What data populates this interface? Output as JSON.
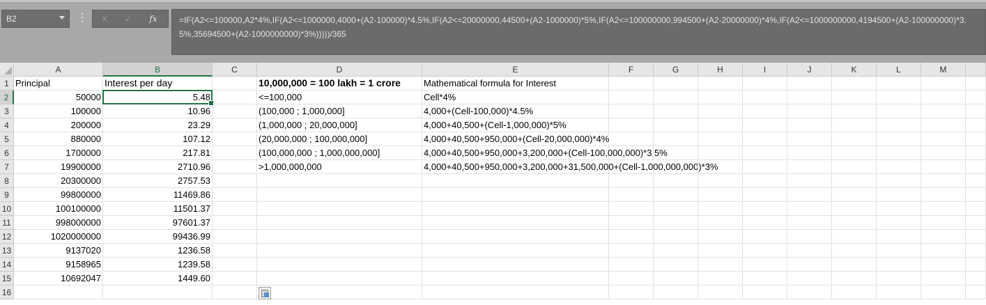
{
  "name_box": {
    "value": "B2"
  },
  "formula_bar": {
    "dots": "⋮",
    "cancel_icon": "✕",
    "enter_icon": "✓",
    "fx_icon": "fx",
    "formula": "=IF(A2<=100000,A2*4%,IF(A2<=1000000,4000+(A2-100000)*4.5%,IF(A2<=20000000,44500+(A2-1000000)*5%,IF(A2<=100000000,994500+(A2-20000000)*4%,IF(A2<=1000000000,4194500+(A2-100000000)*3.5%,35694500+(A2-1000000000)*3%)))))/365"
  },
  "columns": [
    "A",
    "B",
    "C",
    "D",
    "E",
    "F",
    "G",
    "H",
    "I",
    "J",
    "K",
    "L",
    "M"
  ],
  "rows": [
    "1",
    "2",
    "3",
    "4",
    "5",
    "6",
    "7",
    "8",
    "9",
    "10",
    "11",
    "12",
    "13",
    "14",
    "15",
    "16"
  ],
  "selected": {
    "column": "B",
    "row": "2"
  },
  "sheet": {
    "header_a": "Principal",
    "header_b": "Interest per day",
    "principal": [
      "50000",
      "100000",
      "200000",
      "880000",
      "1700000",
      "19900000",
      "20300000",
      "99800000",
      "100100000",
      "998000000",
      "1020000000",
      "9137020",
      "9158965",
      "10692047"
    ],
    "interest": [
      "5.48",
      "10.96",
      "23.29",
      "107.12",
      "217.81",
      "2710.96",
      "2757.53",
      "11469.86",
      "11501.37",
      "97601.37",
      "99436.99",
      "1236.58",
      "1239.58",
      "1449.60"
    ],
    "note_title": "10,000,000 = 100 lakh = 1 crore",
    "formula_title": "Mathematical formula for Interest",
    "ranges": [
      "<=100,000",
      "(100,000 ; 1,000,000]",
      "(1,000,000 ; 20,000,000]",
      "(20,000,000 ; 100,000,000]",
      "(100,000,000 ; 1,000,000,000]",
      ">1,000,000,000"
    ],
    "formulas": [
      "Cell*4%",
      "4,000+(Cell-100,000)*4.5%",
      "4,000+40,500+(Cell-1,000,000)*5%",
      "4,000+40,500+950,000+(Cell-20,000,000)*4%",
      "4,000+40,500+950,000+3,200,000+(Cell-100,000,000)*3.5%",
      "4,000+40,500+950,000+3,200,000+31,500,000+(Cell-1,000,000,000)*3%"
    ]
  },
  "colors": {
    "accent": "#217346",
    "toolbar": "#a8a8a8"
  }
}
